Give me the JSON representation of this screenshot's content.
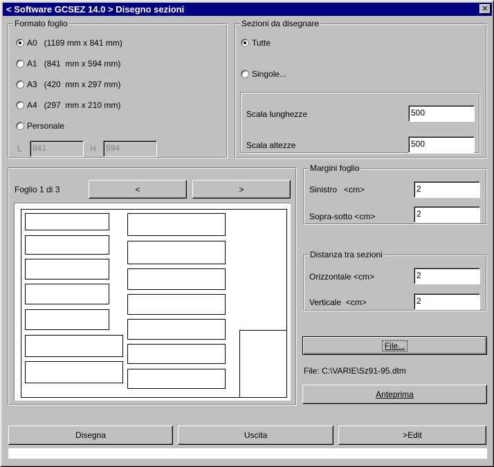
{
  "window": {
    "title": "< Software GCSEZ 14.0 >  Disegno sezioni",
    "close_glyph": "✕"
  },
  "formato": {
    "legend": "Formato foglio",
    "options": [
      {
        "label": "A0   (1189 mm x 841 mm)",
        "checked": true
      },
      {
        "label": "A1   (841  mm x 594 mm)",
        "checked": false
      },
      {
        "label": "A3   (420  mm x 297 mm)",
        "checked": false
      },
      {
        "label": "A4   (297  mm x 210 mm)",
        "checked": false
      },
      {
        "label": "Personale",
        "checked": false
      }
    ],
    "l_label": "L",
    "l_value": "841",
    "h_label": "H",
    "h_value": "594"
  },
  "sezioni": {
    "legend": "Sezioni da disegnare",
    "opt_tutte": "Tutte",
    "opt_singole": "Singole...",
    "scala_lunghezze_label": "Scala lunghezze",
    "scala_lunghezze_value": "500",
    "scala_altezze_label": "Scala altezze",
    "scala_altezze_value": "500"
  },
  "foglio": {
    "label": "Foglio 1 di 3",
    "prev": "<",
    "next": ">"
  },
  "margini": {
    "legend": "Margini foglio",
    "sinistro_label": "Sinistro   <cm>",
    "sinistro_value": "2",
    "sopra_label": "Sopra-sotto <cm>",
    "sopra_value": "2"
  },
  "distanza": {
    "legend": "Distanza tra sezioni",
    "orizz_label": "Orizzontale <cm>",
    "orizz_value": "2",
    "vert_label": "Verticale  <cm>",
    "vert_value": "2"
  },
  "file": {
    "button": "File...",
    "path": "File: C:\\VARIE\\Sz91-95.dtm",
    "anteprima": "Anteprima"
  },
  "footer": {
    "disegna": "Disegna",
    "uscita": "Uscita",
    "edit": ">Edit"
  },
  "colors": {
    "titlebar": "#000080",
    "face": "#c0c0c0"
  }
}
